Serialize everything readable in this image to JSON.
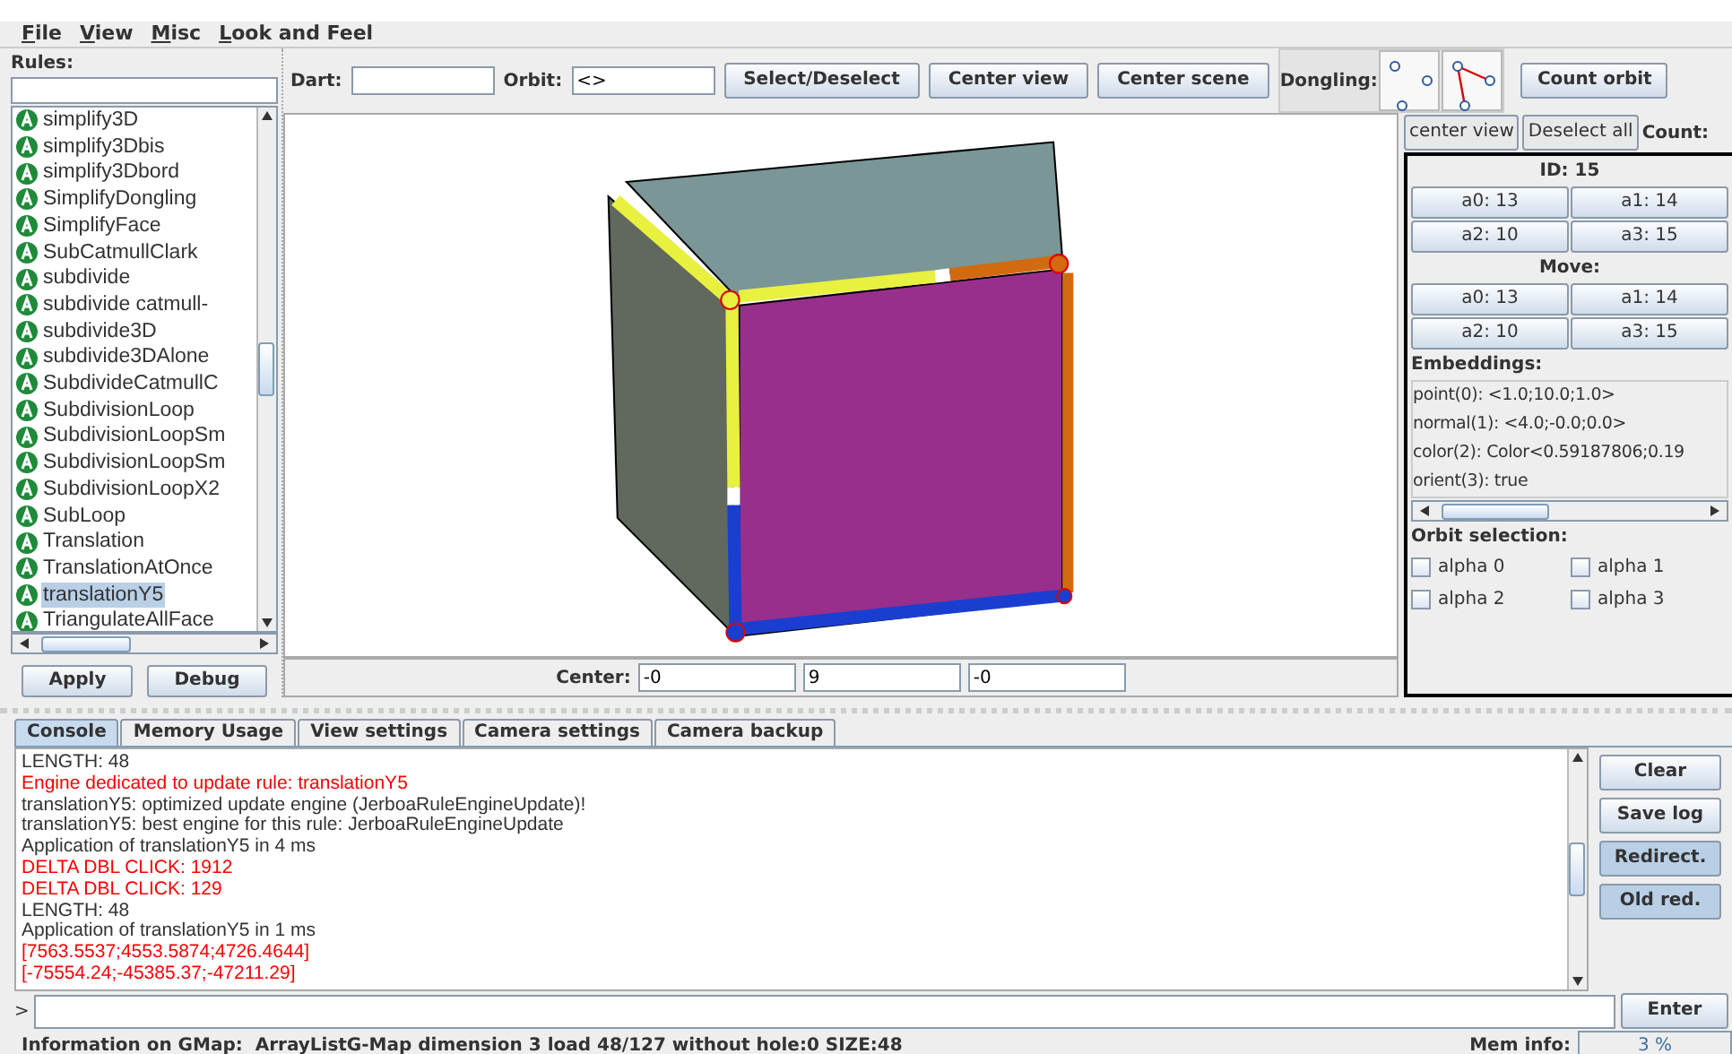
{
  "menu": [
    "File",
    "View",
    "Misc",
    "Look and Feel"
  ],
  "rules": {
    "label": "Rules:",
    "items": [
      {
        "name": "simplify3D",
        "selected": false
      },
      {
        "name": "simplify3Dbis",
        "selected": false
      },
      {
        "name": "simplify3Dbord",
        "selected": false
      },
      {
        "name": "SimplifyDongling",
        "selected": false
      },
      {
        "name": "SimplifyFace",
        "selected": false
      },
      {
        "name": "SubCatmullClark",
        "selected": false
      },
      {
        "name": "subdivide",
        "selected": false
      },
      {
        "name": "subdivide catmull-",
        "selected": false
      },
      {
        "name": "subdivide3D",
        "selected": false
      },
      {
        "name": "subdivide3DAlone",
        "selected": false
      },
      {
        "name": "SubdivideCatmullC",
        "selected": false
      },
      {
        "name": "SubdivisionLoop",
        "selected": false
      },
      {
        "name": "SubdivisionLoopSm",
        "selected": false
      },
      {
        "name": "SubdivisionLoopSm",
        "selected": false
      },
      {
        "name": "SubdivisionLoopX2",
        "selected": false
      },
      {
        "name": "SubLoop",
        "selected": false
      },
      {
        "name": "Translation",
        "selected": false
      },
      {
        "name": "TranslationAtOnce",
        "selected": false
      },
      {
        "name": "translationY5",
        "selected": true
      },
      {
        "name": "TriangulateAllFace",
        "selected": false
      }
    ],
    "buttons": [
      "Apply",
      "Debug"
    ]
  },
  "toolbar": {
    "dart_label": "Dart:",
    "orbit_label": "Orbit:",
    "orbit": "<>",
    "buttons": [
      "Select/Deselect",
      "Center view",
      "Center scene"
    ],
    "dongling_label": "Dongling:",
    "dongling_options": [
      {
        "kind": "dots",
        "selected": false
      },
      {
        "kind": "edges",
        "selected": false
      }
    ],
    "count_button": "Count orbit"
  },
  "center": {
    "label": "Center:",
    "values": [
      "-0",
      "9",
      "-0"
    ]
  },
  "inspector": {
    "buttons": [
      "center view",
      "Deselect all"
    ],
    "count_label": "Count:",
    "id": "ID: 15",
    "alphas": [
      "a0: 13",
      "a1: 14",
      "a2: 10",
      "a3: 15"
    ],
    "move_label": "Move:",
    "moves": [
      "a0: 13",
      "a1: 14",
      "a2: 10",
      "a3: 15"
    ],
    "embeddings_label": "Embeddings:",
    "embeddings": [
      "point(0): <1.0;10.0;1.0>",
      "normal(1): <4.0;-0.0;0.0>",
      "color(2): Color<0.59187806;0.19",
      "orient(3): true"
    ],
    "orbit_label": "Orbit selection:",
    "orbit_checks": [
      {
        "label": "alpha 0",
        "checked": false
      },
      {
        "label": "alpha 1",
        "checked": false
      },
      {
        "label": "alpha 2",
        "checked": false
      },
      {
        "label": "alpha 3",
        "checked": false
      }
    ]
  },
  "tabs": [
    {
      "label": "Console",
      "selected": true
    },
    {
      "label": "Memory Usage",
      "selected": false
    },
    {
      "label": "View settings",
      "selected": false
    },
    {
      "label": "Camera settings",
      "selected": false
    },
    {
      "label": "Camera backup",
      "selected": false
    }
  ],
  "console": {
    "lines": [
      {
        "text": "LENGTH: 48",
        "kind": "normal"
      },
      {
        "text": "Engine dedicated to update rule: translationY5",
        "kind": "error"
      },
      {
        "text": "translationY5: optimized update engine (JerboaRuleEngineUpdate)!",
        "kind": "normal"
      },
      {
        "text": "translationY5: best engine for this rule: JerboaRuleEngineUpdate",
        "kind": "normal"
      },
      {
        "text": "Application of translationY5 in 4 ms",
        "kind": "normal"
      },
      {
        "text": "DELTA DBL CLICK: 1912",
        "kind": "error"
      },
      {
        "text": "DELTA DBL CLICK: 129",
        "kind": "error"
      },
      {
        "text": "LENGTH: 48",
        "kind": "normal"
      },
      {
        "text": "Application of translationY5 in 1 ms",
        "kind": "normal"
      },
      {
        "text": "[7563.5537;4553.5874;4726.4644]",
        "kind": "error"
      },
      {
        "text": "[-75554.24;-45385.37;-47211.29]",
        "kind": "error"
      }
    ],
    "buttons": [
      {
        "label": "Clear",
        "selected": false
      },
      {
        "label": "Save log",
        "selected": false
      },
      {
        "label": "Redirect.",
        "selected": true
      },
      {
        "label": "Old red.",
        "selected": true
      }
    ],
    "prompt": ">",
    "enter": "Enter"
  },
  "status": {
    "info": "Information on GMap:  ArrayListG-Map dimension 3 load 48/127 without hole:0 SIZE:48",
    "mem_label": "Mem info:",
    "mem": "3 %"
  }
}
